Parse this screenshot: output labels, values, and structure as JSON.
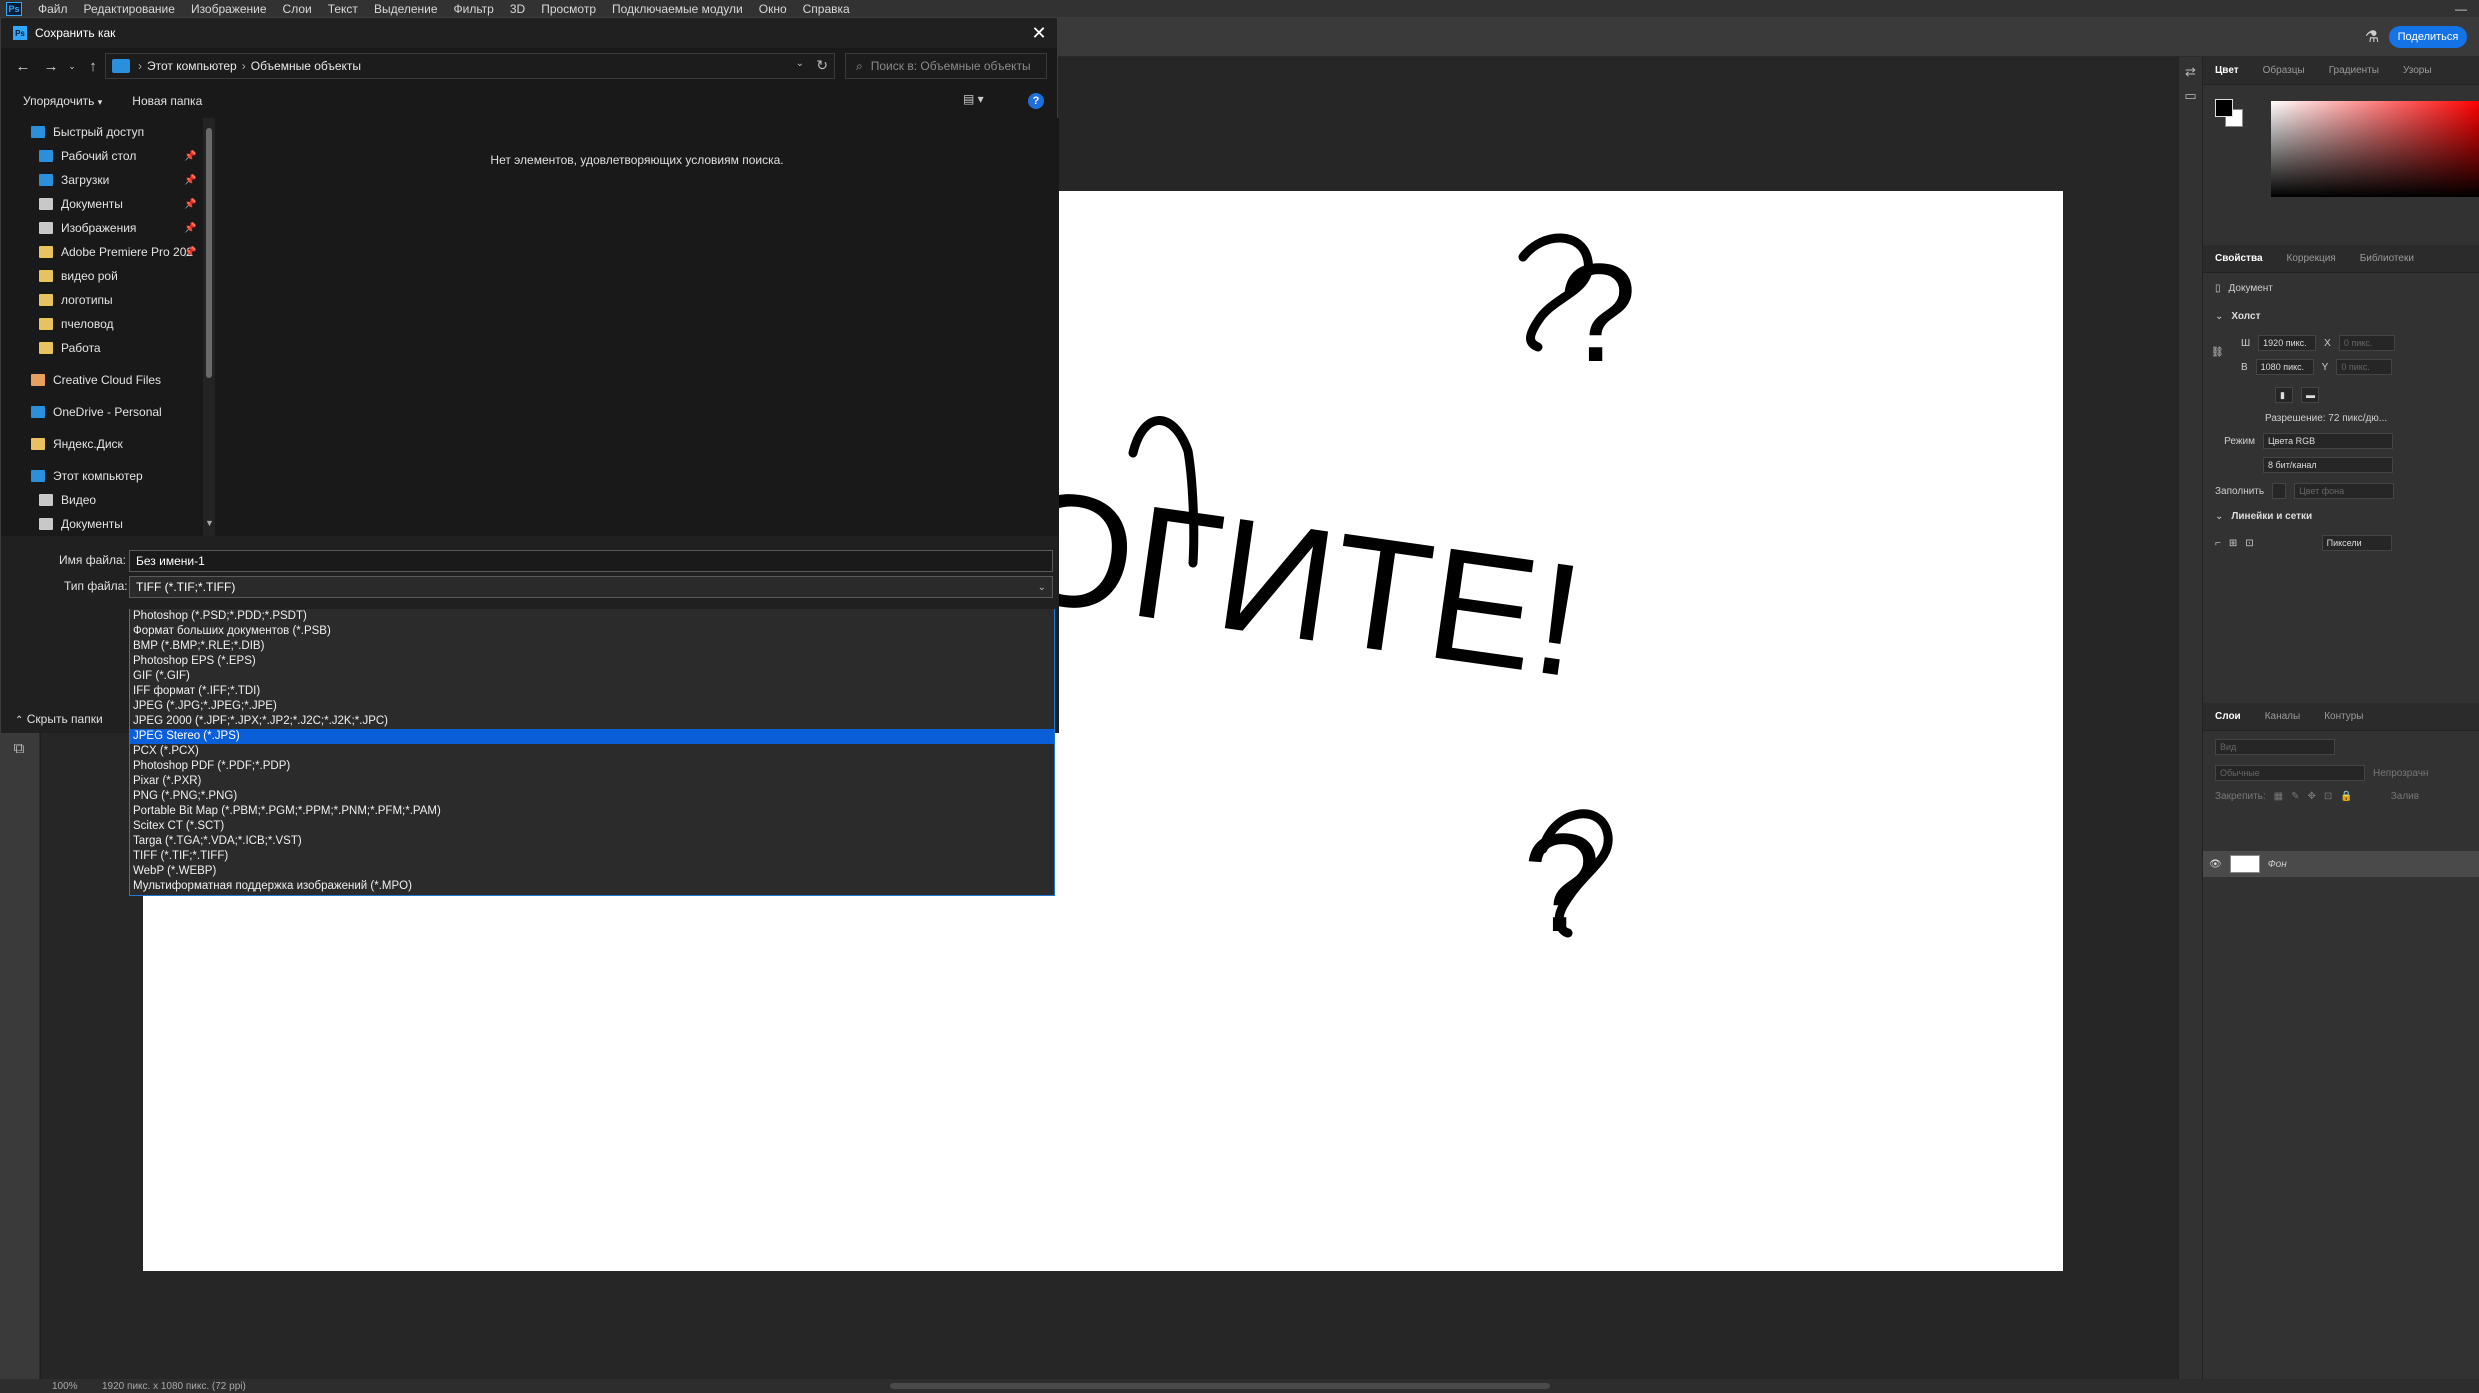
{
  "app": {
    "logo": "Ps",
    "menu": [
      "Файл",
      "Редактирование",
      "Изображение",
      "Слои",
      "Текст",
      "Выделение",
      "Фильтр",
      "3D",
      "Просмотр",
      "Подключаемые модули",
      "Окно",
      "Справка"
    ],
    "minimize_glyph": "—",
    "share_label": "Поделиться"
  },
  "canvas": {
    "drawing_text": "ПОМОГИТЕ!",
    "question_marks": [
      "?",
      "?"
    ]
  },
  "status": {
    "zoom": "100%",
    "doc_info": "1920 пикс. x 1080 пикс. (72 ppi)"
  },
  "panels": {
    "color_tabs": [
      "Цвет",
      "Образцы",
      "Градиенты",
      "Узоры"
    ],
    "props_tabs": [
      "Свойства",
      "Коррекция",
      "Библиотеки"
    ],
    "document_label": "Документ",
    "canvas_section": "Холст",
    "width_label": "Ш",
    "width_value": "1920 пикс.",
    "height_label": "В",
    "height_value": "1080 пикс.",
    "x_label": "X",
    "x_value": "0 пикс.",
    "y_label": "Y",
    "y_value": "0 пикс.",
    "resolution": "Разрешение: 72 пикс/дю...",
    "mode_label": "Режим",
    "mode_value": "Цвета RGB",
    "bits_value": "8 бит/канал",
    "fill_label": "Заполнить",
    "fill_value": "Цвет фона",
    "rulers_section": "Линейки и сетки",
    "units_value": "Пиксели",
    "layers_tabs": [
      "Слои",
      "Каналы",
      "Контуры"
    ],
    "layers_search": "Вид",
    "blend_mode": "Обычные",
    "opacity_label": "Непрозрачн",
    "lock_label": "Закрепить:",
    "fill_short": "Залив",
    "layer_name": "Фон"
  },
  "dialog": {
    "title": "Сохранить как",
    "breadcrumbs": [
      "Этот компьютер",
      "Объемные объекты"
    ],
    "search_placeholder": "Поиск в: Объемные объекты",
    "organize": "Упорядочить",
    "new_folder": "Новая папка",
    "empty_message": "Нет элементов, удовлетворяющих условиям поиска.",
    "nav_items": [
      {
        "label": "Быстрый доступ",
        "icon": "star-icon",
        "color": "#2b8fdb",
        "pinned": false
      },
      {
        "label": "Рабочий стол",
        "icon": "desktop-folder-icon",
        "color": "#2b8fdb",
        "pinned": true
      },
      {
        "label": "Загрузки",
        "icon": "download-icon",
        "color": "#2b8fdb",
        "pinned": true
      },
      {
        "label": "Документы",
        "icon": "document-icon",
        "color": "#c8c8c8",
        "pinned": true
      },
      {
        "label": "Изображения",
        "icon": "pictures-icon",
        "color": "#c8c8c8",
        "pinned": true
      },
      {
        "label": "Adobe Premiere Pro 202",
        "icon": "folder-icon",
        "color": "#e8c160",
        "pinned": true
      },
      {
        "label": "видео рой",
        "icon": "folder-icon",
        "color": "#e8c160",
        "pinned": false
      },
      {
        "label": "логотипы",
        "icon": "folder-icon",
        "color": "#e8c160",
        "pinned": false
      },
      {
        "label": "пчеловод",
        "icon": "folder-icon",
        "color": "#e8c160",
        "pinned": false
      },
      {
        "label": "Работа",
        "icon": "folder-icon",
        "color": "#e8c160",
        "pinned": false
      },
      {
        "label": "Creative Cloud Files",
        "icon": "creative-cloud-icon",
        "color": "#e8a060",
        "pinned": false
      },
      {
        "label": "OneDrive - Personal",
        "icon": "onedrive-icon",
        "color": "#2b8fdb",
        "pinned": false
      },
      {
        "label": "Яндекс.Диск",
        "icon": "yandex-disk-icon",
        "color": "#e8c160",
        "pinned": false
      },
      {
        "label": "Этот компьютер",
        "icon": "computer-icon",
        "color": "#2b8fdb",
        "pinned": false
      },
      {
        "label": "Видео",
        "icon": "video-folder-icon",
        "color": "#c8c8c8",
        "pinned": false
      },
      {
        "label": "Документы",
        "icon": "document-icon",
        "color": "#c8c8c8",
        "pinned": false
      }
    ],
    "filename_label": "Имя файла:",
    "filename_value": "Без имени-1",
    "filetype_label": "Тип файла:",
    "filetype_value": "TIFF (*.TIF;*.TIFF)",
    "hide_folders": "Скрыть папки",
    "filetype_options": [
      "Photoshop (*.PSD;*.PDD;*.PSDT)",
      "Формат больших документов (*.PSB)",
      "BMP (*.BMP;*.RLE;*.DIB)",
      "Photoshop EPS (*.EPS)",
      "GIF (*.GIF)",
      "IFF формат (*.IFF;*.TDI)",
      "JPEG (*.JPG;*.JPEG;*.JPE)",
      "JPEG 2000 (*.JPF;*.JPX;*.JP2;*.J2C;*.J2K;*.JPC)",
      "JPEG Stereo (*.JPS)",
      "PCX (*.PCX)",
      "Photoshop PDF (*.PDF;*.PDP)",
      "Pixar (*.PXR)",
      "PNG (*.PNG;*.PNG)",
      "Portable Bit Map (*.PBM;*.PGM;*.PPM;*.PNM;*.PFM;*.PAM)",
      "Scitex CT (*.SCT)",
      "Targa (*.TGA;*.VDA;*.ICB;*.VST)",
      "TIFF (*.TIF;*.TIFF)",
      "WebP (*.WEBP)",
      "Мультиформатная поддержка изображений  (*.MPO)"
    ],
    "selected_option": "JPEG Stereo (*.JPS)"
  }
}
